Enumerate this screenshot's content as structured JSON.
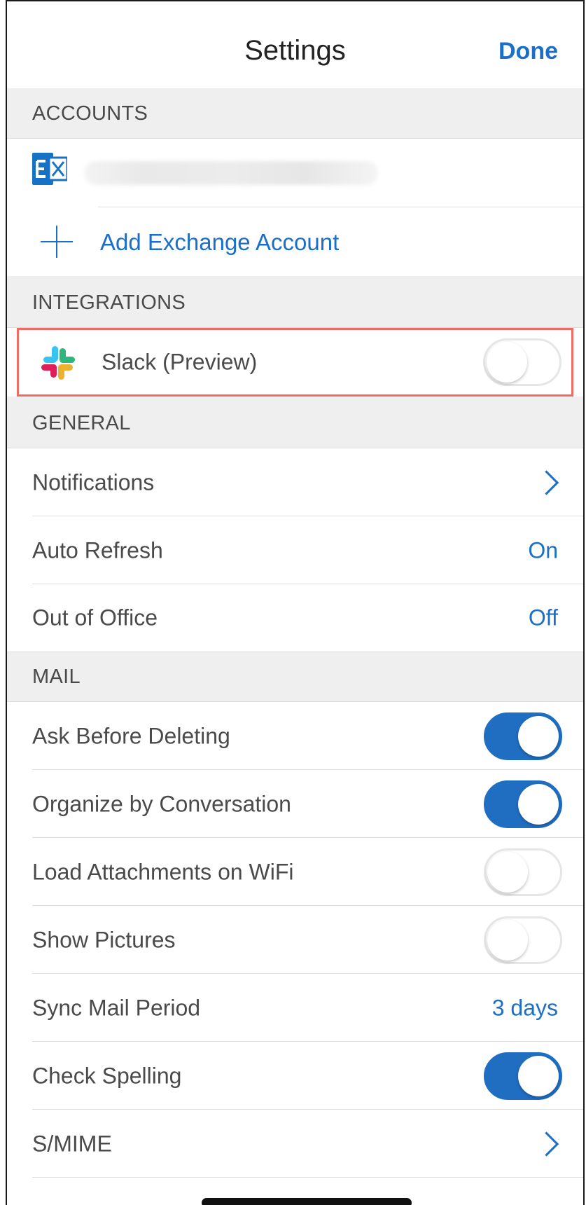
{
  "header": {
    "title": "Settings",
    "done_label": "Done"
  },
  "sections": {
    "accounts": "ACCOUNTS",
    "integrations": "INTEGRATIONS",
    "general": "GENERAL",
    "mail": "MAIL"
  },
  "accounts": {
    "account_icon": "exchange-icon",
    "add_label": "Add Exchange Account",
    "add_icon": "plus-icon"
  },
  "integrations": {
    "slack_label": "Slack (Preview)",
    "slack_enabled": false
  },
  "general": {
    "notifications_label": "Notifications",
    "auto_refresh_label": "Auto Refresh",
    "auto_refresh_value": "On",
    "out_of_office_label": "Out of Office",
    "out_of_office_value": "Off"
  },
  "mail": {
    "ask_before_deleting_label": "Ask Before Deleting",
    "ask_before_deleting_on": true,
    "organize_label": "Organize by Conversation",
    "organize_on": true,
    "load_attachments_label": "Load Attachments on WiFi",
    "load_attachments_on": false,
    "show_pictures_label": "Show Pictures",
    "show_pictures_on": false,
    "sync_period_label": "Sync Mail Period",
    "sync_period_value": "3 days",
    "check_spelling_label": "Check Spelling",
    "check_spelling_on": true,
    "smime_label": "S/MIME"
  },
  "colors": {
    "accent": "#1b6fc8",
    "toggle_on": "#1f6ec2",
    "highlight_border": "#f06b62",
    "section_bg": "#efefef"
  }
}
